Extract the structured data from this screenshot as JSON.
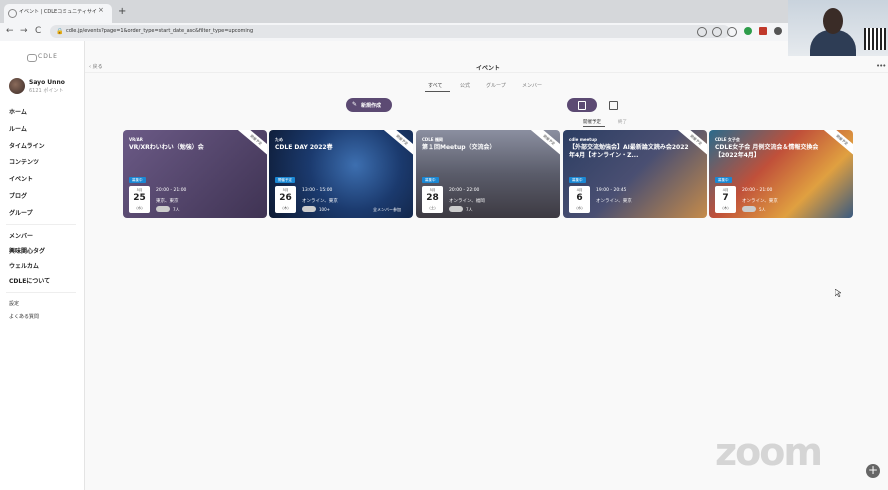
{
  "browser": {
    "tab_title": "イベント | CDLEコミュニティサイト(β版)",
    "tab_close": "×",
    "new_tab": "+",
    "nav_back": "←",
    "nav_forward": "→",
    "nav_reload": "C",
    "url": "cdle.jp/events?page=1&order_type=start_date_asc&filter_type=upcoming",
    "lock": "🔒"
  },
  "colors": {
    "accent": "#5c4a73",
    "badge_blue": "#1a88d4"
  },
  "sidebar": {
    "logo": "CDLE",
    "user_name": "Sayo Unno",
    "user_meta": "6121 ポイント",
    "nav": [
      "ホーム",
      "ルーム",
      "タイムライン",
      "コンテンツ",
      "イベント",
      "ブログ",
      "グループ"
    ],
    "nav_secondary": [
      "メンバー",
      "興味関心タグ",
      "ウェルカム",
      "CDLEについて"
    ],
    "footer": [
      "設定",
      "よくある質問"
    ]
  },
  "header": {
    "back": "‹ 戻る",
    "title": "イベント",
    "more": "•••",
    "tabs": [
      "すべて",
      "公式",
      "グループ",
      "メンバー"
    ]
  },
  "toolbar": {
    "create_label": "新規作成",
    "create_icon": "✎",
    "filter_upcoming": "開催予定",
    "filter_ended": "終了"
  },
  "cards": [
    {
      "category": "VR/AR",
      "title": "VR/XRわいわい（勉強）会",
      "badge": "募集中",
      "month": "5月",
      "day": "25",
      "weekday": "(水)",
      "time": "20:00 - 21:00",
      "location": "東京、東京",
      "count": "7人",
      "extra": "",
      "ribbon": "開催予定"
    },
    {
      "category": "ため",
      "title": "CDLE DAY 2022春",
      "badge": "開催予定",
      "month": "5月",
      "day": "26",
      "weekday": "(木)",
      "time": "13:00 - 15:00",
      "location": "オンライン、東京",
      "count": "100+",
      "extra": "全メンバー参加",
      "ribbon": "開催予定"
    },
    {
      "category": "CDLE 福岡",
      "title": "第１回Meetup（交流会）",
      "badge": "募集中",
      "month": "5月",
      "day": "28",
      "weekday": "(土)",
      "time": "20:00 - 22:00",
      "location": "オンライン、福岡",
      "count": "7人",
      "extra": "",
      "ribbon": "開催予定"
    },
    {
      "category": "cdle meetup",
      "title": "【外部交流勉強会】AI最新論文読み会2022年4月【オンライン・Z...",
      "badge": "募集中",
      "month": "4月",
      "day": "6",
      "weekday": "(水)",
      "time": "19:00 - 20:45",
      "location": "オンライン、東京",
      "count": "",
      "extra": "",
      "ribbon": "開催予定"
    },
    {
      "category": "CDLE 女子会",
      "title": "CDLE女子会 月例交流会＆情報交換会【2022年4月】",
      "badge": "募集中",
      "month": "4月",
      "day": "7",
      "weekday": "(木)",
      "time": "20:00 - 21:00",
      "location": "オンライン、東京",
      "count": "5人",
      "extra": "",
      "ribbon": "開催予定"
    }
  ],
  "zoom": {
    "logo": "zoom",
    "plus": "+"
  }
}
